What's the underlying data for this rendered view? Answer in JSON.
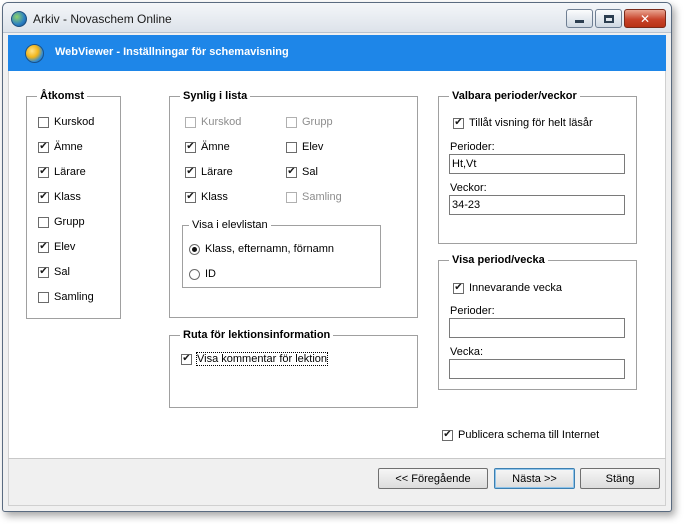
{
  "window": {
    "title": "Arkiv - Novaschem Online"
  },
  "banner": {
    "title": "WebViewer - Inställningar för schemavisning"
  },
  "atkomst": {
    "title": "Åtkomst",
    "items": [
      {
        "label": "Kurskod",
        "checked": false
      },
      {
        "label": "Ämne",
        "checked": true
      },
      {
        "label": "Lärare",
        "checked": true
      },
      {
        "label": "Klass",
        "checked": true
      },
      {
        "label": "Grupp",
        "checked": false
      },
      {
        "label": "Elev",
        "checked": true
      },
      {
        "label": "Sal",
        "checked": true
      },
      {
        "label": "Samling",
        "checked": false
      }
    ]
  },
  "synlig": {
    "title": "Synlig i lista",
    "col1": [
      {
        "label": "Kurskod",
        "checked": false,
        "disabled": true
      },
      {
        "label": "Ämne",
        "checked": true,
        "disabled": false
      },
      {
        "label": "Lärare",
        "checked": true,
        "disabled": false
      },
      {
        "label": "Klass",
        "checked": true,
        "disabled": false
      }
    ],
    "col2": [
      {
        "label": "Grupp",
        "checked": false,
        "disabled": true
      },
      {
        "label": "Elev",
        "checked": false,
        "disabled": false
      },
      {
        "label": "Sal",
        "checked": true,
        "disabled": false
      },
      {
        "label": "Samling",
        "checked": false,
        "disabled": true
      }
    ],
    "elevlistan": {
      "title": "Visa i elevlistan",
      "options": [
        {
          "label": "Klass, efternamn, förnamn",
          "selected": true
        },
        {
          "label": "ID",
          "selected": false
        }
      ]
    }
  },
  "ruta": {
    "title": "Ruta för lektionsinformation",
    "item": {
      "label": "Visa kommentar för lektion",
      "checked": true
    }
  },
  "valbara": {
    "title": "Valbara perioder/veckor",
    "helt_lasar": {
      "label": "Tillåt visning för helt läsår",
      "checked": true
    },
    "perioder_label": "Perioder:",
    "perioder_value": "Ht,Vt",
    "veckor_label": "Veckor:",
    "veckor_value": "34-23"
  },
  "visa_period": {
    "title": "Visa period/vecka",
    "innevarande": {
      "label": "Innevarande vecka",
      "checked": true
    },
    "perioder_label": "Perioder:",
    "perioder_value": "",
    "vecka_label": "Vecka:",
    "vecka_value": ""
  },
  "publicera": {
    "label": "Publicera schema till Internet",
    "checked": true
  },
  "buttons": {
    "previous": "<< Föregående",
    "next": "Nästa >>",
    "close": "Stäng"
  },
  "icons": {
    "check": "✔"
  }
}
